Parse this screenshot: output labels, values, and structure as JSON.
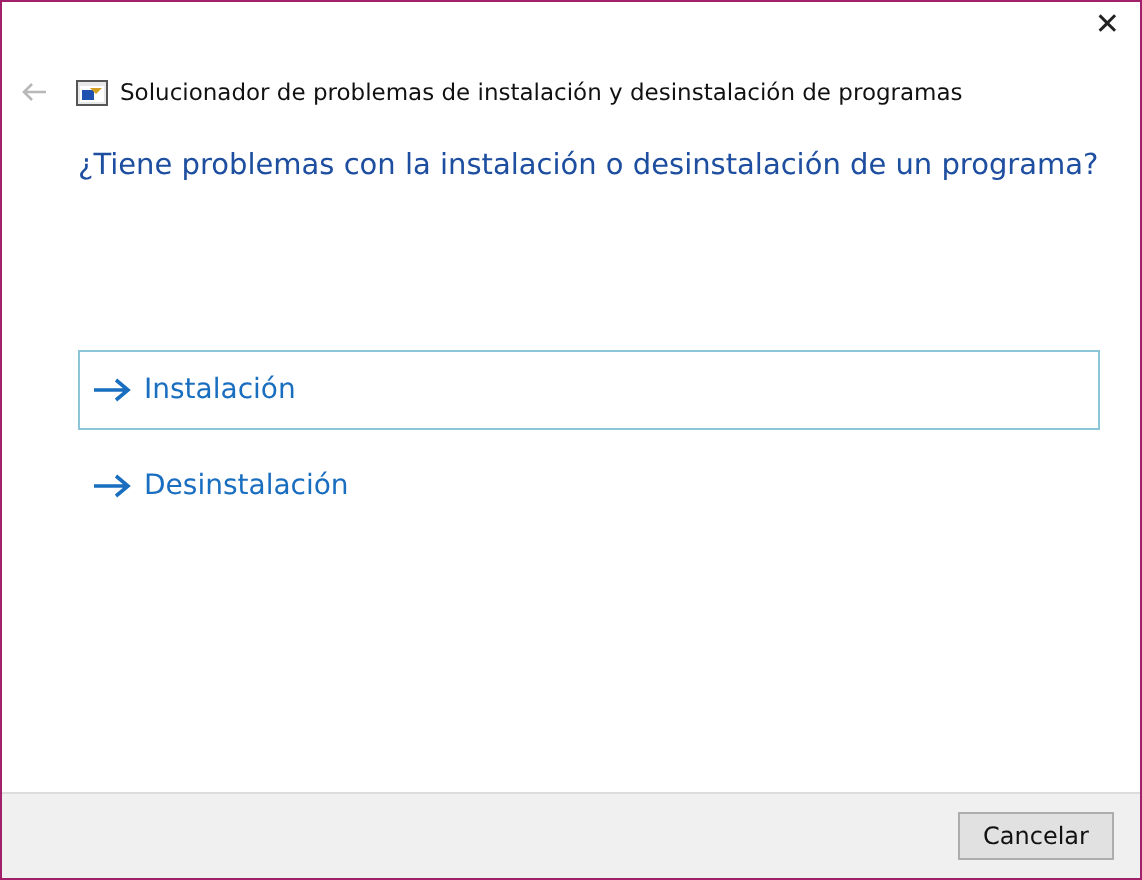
{
  "window": {
    "title": "Solucionador de problemas de instalación y desinstalación de programas",
    "close": "✕"
  },
  "heading": "¿Tiene problemas con la instalación o desinstalación de un programa?",
  "options": [
    {
      "label": "Instalación",
      "highlighted": true
    },
    {
      "label": "Desinstalación",
      "highlighted": false
    }
  ],
  "buttons": [
    "Cancelar"
  ]
}
